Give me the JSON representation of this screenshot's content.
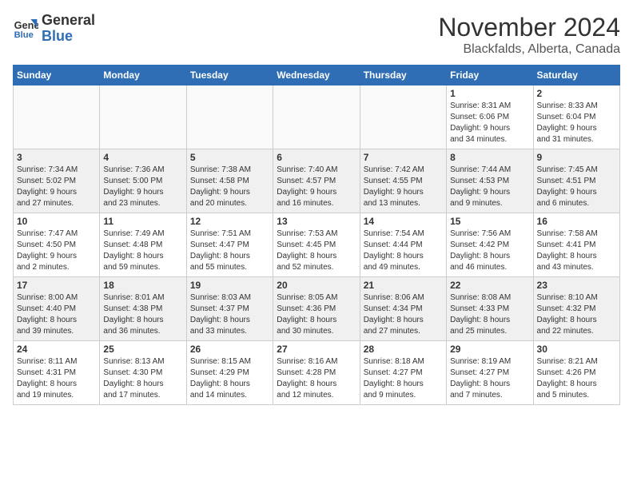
{
  "header": {
    "logo_line1": "General",
    "logo_line2": "Blue",
    "month_title": "November 2024",
    "subtitle": "Blackfalds, Alberta, Canada"
  },
  "weekdays": [
    "Sunday",
    "Monday",
    "Tuesday",
    "Wednesday",
    "Thursday",
    "Friday",
    "Saturday"
  ],
  "weeks": [
    [
      {
        "day": "",
        "info": ""
      },
      {
        "day": "",
        "info": ""
      },
      {
        "day": "",
        "info": ""
      },
      {
        "day": "",
        "info": ""
      },
      {
        "day": "",
        "info": ""
      },
      {
        "day": "1",
        "info": "Sunrise: 8:31 AM\nSunset: 6:06 PM\nDaylight: 9 hours\nand 34 minutes."
      },
      {
        "day": "2",
        "info": "Sunrise: 8:33 AM\nSunset: 6:04 PM\nDaylight: 9 hours\nand 31 minutes."
      }
    ],
    [
      {
        "day": "3",
        "info": "Sunrise: 7:34 AM\nSunset: 5:02 PM\nDaylight: 9 hours\nand 27 minutes."
      },
      {
        "day": "4",
        "info": "Sunrise: 7:36 AM\nSunset: 5:00 PM\nDaylight: 9 hours\nand 23 minutes."
      },
      {
        "day": "5",
        "info": "Sunrise: 7:38 AM\nSunset: 4:58 PM\nDaylight: 9 hours\nand 20 minutes."
      },
      {
        "day": "6",
        "info": "Sunrise: 7:40 AM\nSunset: 4:57 PM\nDaylight: 9 hours\nand 16 minutes."
      },
      {
        "day": "7",
        "info": "Sunrise: 7:42 AM\nSunset: 4:55 PM\nDaylight: 9 hours\nand 13 minutes."
      },
      {
        "day": "8",
        "info": "Sunrise: 7:44 AM\nSunset: 4:53 PM\nDaylight: 9 hours\nand 9 minutes."
      },
      {
        "day": "9",
        "info": "Sunrise: 7:45 AM\nSunset: 4:51 PM\nDaylight: 9 hours\nand 6 minutes."
      }
    ],
    [
      {
        "day": "10",
        "info": "Sunrise: 7:47 AM\nSunset: 4:50 PM\nDaylight: 9 hours\nand 2 minutes."
      },
      {
        "day": "11",
        "info": "Sunrise: 7:49 AM\nSunset: 4:48 PM\nDaylight: 8 hours\nand 59 minutes."
      },
      {
        "day": "12",
        "info": "Sunrise: 7:51 AM\nSunset: 4:47 PM\nDaylight: 8 hours\nand 55 minutes."
      },
      {
        "day": "13",
        "info": "Sunrise: 7:53 AM\nSunset: 4:45 PM\nDaylight: 8 hours\nand 52 minutes."
      },
      {
        "day": "14",
        "info": "Sunrise: 7:54 AM\nSunset: 4:44 PM\nDaylight: 8 hours\nand 49 minutes."
      },
      {
        "day": "15",
        "info": "Sunrise: 7:56 AM\nSunset: 4:42 PM\nDaylight: 8 hours\nand 46 minutes."
      },
      {
        "day": "16",
        "info": "Sunrise: 7:58 AM\nSunset: 4:41 PM\nDaylight: 8 hours\nand 43 minutes."
      }
    ],
    [
      {
        "day": "17",
        "info": "Sunrise: 8:00 AM\nSunset: 4:40 PM\nDaylight: 8 hours\nand 39 minutes."
      },
      {
        "day": "18",
        "info": "Sunrise: 8:01 AM\nSunset: 4:38 PM\nDaylight: 8 hours\nand 36 minutes."
      },
      {
        "day": "19",
        "info": "Sunrise: 8:03 AM\nSunset: 4:37 PM\nDaylight: 8 hours\nand 33 minutes."
      },
      {
        "day": "20",
        "info": "Sunrise: 8:05 AM\nSunset: 4:36 PM\nDaylight: 8 hours\nand 30 minutes."
      },
      {
        "day": "21",
        "info": "Sunrise: 8:06 AM\nSunset: 4:34 PM\nDaylight: 8 hours\nand 27 minutes."
      },
      {
        "day": "22",
        "info": "Sunrise: 8:08 AM\nSunset: 4:33 PM\nDaylight: 8 hours\nand 25 minutes."
      },
      {
        "day": "23",
        "info": "Sunrise: 8:10 AM\nSunset: 4:32 PM\nDaylight: 8 hours\nand 22 minutes."
      }
    ],
    [
      {
        "day": "24",
        "info": "Sunrise: 8:11 AM\nSunset: 4:31 PM\nDaylight: 8 hours\nand 19 minutes."
      },
      {
        "day": "25",
        "info": "Sunrise: 8:13 AM\nSunset: 4:30 PM\nDaylight: 8 hours\nand 17 minutes."
      },
      {
        "day": "26",
        "info": "Sunrise: 8:15 AM\nSunset: 4:29 PM\nDaylight: 8 hours\nand 14 minutes."
      },
      {
        "day": "27",
        "info": "Sunrise: 8:16 AM\nSunset: 4:28 PM\nDaylight: 8 hours\nand 12 minutes."
      },
      {
        "day": "28",
        "info": "Sunrise: 8:18 AM\nSunset: 4:27 PM\nDaylight: 8 hours\nand 9 minutes."
      },
      {
        "day": "29",
        "info": "Sunrise: 8:19 AM\nSunset: 4:27 PM\nDaylight: 8 hours\nand 7 minutes."
      },
      {
        "day": "30",
        "info": "Sunrise: 8:21 AM\nSunset: 4:26 PM\nDaylight: 8 hours\nand 5 minutes."
      }
    ]
  ]
}
